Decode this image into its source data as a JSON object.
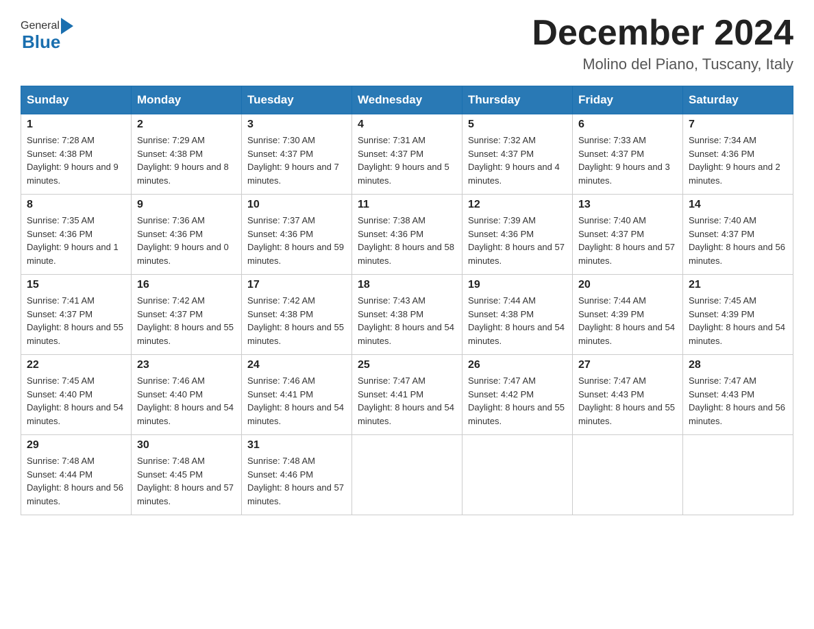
{
  "header": {
    "title": "December 2024",
    "subtitle": "Molino del Piano, Tuscany, Italy",
    "logo_general": "General",
    "logo_blue": "Blue"
  },
  "days_of_week": [
    "Sunday",
    "Monday",
    "Tuesday",
    "Wednesday",
    "Thursday",
    "Friday",
    "Saturday"
  ],
  "weeks": [
    [
      {
        "day": "1",
        "sunrise": "7:28 AM",
        "sunset": "4:38 PM",
        "daylight": "9 hours and 9 minutes."
      },
      {
        "day": "2",
        "sunrise": "7:29 AM",
        "sunset": "4:38 PM",
        "daylight": "9 hours and 8 minutes."
      },
      {
        "day": "3",
        "sunrise": "7:30 AM",
        "sunset": "4:37 PM",
        "daylight": "9 hours and 7 minutes."
      },
      {
        "day": "4",
        "sunrise": "7:31 AM",
        "sunset": "4:37 PM",
        "daylight": "9 hours and 5 minutes."
      },
      {
        "day": "5",
        "sunrise": "7:32 AM",
        "sunset": "4:37 PM",
        "daylight": "9 hours and 4 minutes."
      },
      {
        "day": "6",
        "sunrise": "7:33 AM",
        "sunset": "4:37 PM",
        "daylight": "9 hours and 3 minutes."
      },
      {
        "day": "7",
        "sunrise": "7:34 AM",
        "sunset": "4:36 PM",
        "daylight": "9 hours and 2 minutes."
      }
    ],
    [
      {
        "day": "8",
        "sunrise": "7:35 AM",
        "sunset": "4:36 PM",
        "daylight": "9 hours and 1 minute."
      },
      {
        "day": "9",
        "sunrise": "7:36 AM",
        "sunset": "4:36 PM",
        "daylight": "9 hours and 0 minutes."
      },
      {
        "day": "10",
        "sunrise": "7:37 AM",
        "sunset": "4:36 PM",
        "daylight": "8 hours and 59 minutes."
      },
      {
        "day": "11",
        "sunrise": "7:38 AM",
        "sunset": "4:36 PM",
        "daylight": "8 hours and 58 minutes."
      },
      {
        "day": "12",
        "sunrise": "7:39 AM",
        "sunset": "4:36 PM",
        "daylight": "8 hours and 57 minutes."
      },
      {
        "day": "13",
        "sunrise": "7:40 AM",
        "sunset": "4:37 PM",
        "daylight": "8 hours and 57 minutes."
      },
      {
        "day": "14",
        "sunrise": "7:40 AM",
        "sunset": "4:37 PM",
        "daylight": "8 hours and 56 minutes."
      }
    ],
    [
      {
        "day": "15",
        "sunrise": "7:41 AM",
        "sunset": "4:37 PM",
        "daylight": "8 hours and 55 minutes."
      },
      {
        "day": "16",
        "sunrise": "7:42 AM",
        "sunset": "4:37 PM",
        "daylight": "8 hours and 55 minutes."
      },
      {
        "day": "17",
        "sunrise": "7:42 AM",
        "sunset": "4:38 PM",
        "daylight": "8 hours and 55 minutes."
      },
      {
        "day": "18",
        "sunrise": "7:43 AM",
        "sunset": "4:38 PM",
        "daylight": "8 hours and 54 minutes."
      },
      {
        "day": "19",
        "sunrise": "7:44 AM",
        "sunset": "4:38 PM",
        "daylight": "8 hours and 54 minutes."
      },
      {
        "day": "20",
        "sunrise": "7:44 AM",
        "sunset": "4:39 PM",
        "daylight": "8 hours and 54 minutes."
      },
      {
        "day": "21",
        "sunrise": "7:45 AM",
        "sunset": "4:39 PM",
        "daylight": "8 hours and 54 minutes."
      }
    ],
    [
      {
        "day": "22",
        "sunrise": "7:45 AM",
        "sunset": "4:40 PM",
        "daylight": "8 hours and 54 minutes."
      },
      {
        "day": "23",
        "sunrise": "7:46 AM",
        "sunset": "4:40 PM",
        "daylight": "8 hours and 54 minutes."
      },
      {
        "day": "24",
        "sunrise": "7:46 AM",
        "sunset": "4:41 PM",
        "daylight": "8 hours and 54 minutes."
      },
      {
        "day": "25",
        "sunrise": "7:47 AM",
        "sunset": "4:41 PM",
        "daylight": "8 hours and 54 minutes."
      },
      {
        "day": "26",
        "sunrise": "7:47 AM",
        "sunset": "4:42 PM",
        "daylight": "8 hours and 55 minutes."
      },
      {
        "day": "27",
        "sunrise": "7:47 AM",
        "sunset": "4:43 PM",
        "daylight": "8 hours and 55 minutes."
      },
      {
        "day": "28",
        "sunrise": "7:47 AM",
        "sunset": "4:43 PM",
        "daylight": "8 hours and 56 minutes."
      }
    ],
    [
      {
        "day": "29",
        "sunrise": "7:48 AM",
        "sunset": "4:44 PM",
        "daylight": "8 hours and 56 minutes."
      },
      {
        "day": "30",
        "sunrise": "7:48 AM",
        "sunset": "4:45 PM",
        "daylight": "8 hours and 57 minutes."
      },
      {
        "day": "31",
        "sunrise": "7:48 AM",
        "sunset": "4:46 PM",
        "daylight": "8 hours and 57 minutes."
      },
      null,
      null,
      null,
      null
    ]
  ]
}
